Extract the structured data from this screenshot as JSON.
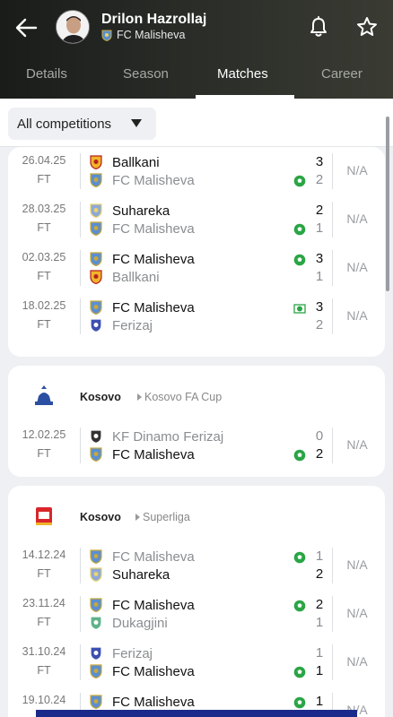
{
  "header": {
    "player_name": "Drilon Hazrollaj",
    "team_name": "FC Malisheva",
    "tabs": [
      {
        "label": "Details"
      },
      {
        "label": "Season"
      },
      {
        "label": "Matches"
      },
      {
        "label": "Career"
      }
    ],
    "active_tab": "Matches",
    "accent_color": "#ffffff"
  },
  "filter": {
    "selected": "All competitions"
  },
  "groups": [
    {
      "matches": [
        {
          "date": "26.04.25",
          "status": "FT",
          "home": "Ballkani",
          "away": "FC Malisheva",
          "home_score": "3",
          "away_score": "2",
          "rating": "N/A"
        },
        {
          "date": "28.03.25",
          "status": "FT",
          "home": "Suhareka",
          "away": "FC Malisheva",
          "home_score": "2",
          "away_score": "1",
          "rating": "N/A"
        },
        {
          "date": "02.03.25",
          "status": "FT",
          "home": "FC Malisheva",
          "away": "Ballkani",
          "home_score": "3",
          "away_score": "1",
          "rating": "N/A"
        },
        {
          "date": "18.02.25",
          "status": "FT",
          "home": "FC Malisheva",
          "away": "Ferizaj",
          "home_score": "3",
          "away_score": "2",
          "rating": "N/A"
        }
      ]
    },
    {
      "country": "Kosovo",
      "competition": "Kosovo FA Cup",
      "matches": [
        {
          "date": "12.02.25",
          "status": "FT",
          "home": "KF Dinamo Ferizaj",
          "away": "FC Malisheva",
          "home_score": "0",
          "away_score": "2",
          "rating": "N/A"
        }
      ]
    },
    {
      "country": "Kosovo",
      "competition": "Superliga",
      "matches": [
        {
          "date": "14.12.24",
          "status": "FT",
          "home": "FC Malisheva",
          "away": "Suhareka",
          "home_score": "1",
          "away_score": "2",
          "rating": "N/A"
        },
        {
          "date": "23.11.24",
          "status": "FT",
          "home": "FC Malisheva",
          "away": "Dukagjini",
          "home_score": "2",
          "away_score": "1",
          "rating": "N/A"
        },
        {
          "date": "31.10.24",
          "status": "FT",
          "home": "Ferizaj",
          "away": "FC Malisheva",
          "home_score": "1",
          "away_score": "1",
          "rating": "N/A"
        },
        {
          "date": "19.10.24",
          "status": "FT",
          "home": "FC Malisheva",
          "away": "",
          "home_score": "1",
          "away_score": "",
          "rating": "N/A"
        }
      ]
    }
  ],
  "icons": [
    "back-arrow-icon",
    "bell-icon",
    "star-icon",
    "dropdown-caret-icon",
    "goal-ball-icon",
    "team-crest-icon",
    "competition-logo-icon"
  ],
  "colors": {
    "goal_icon": "#2aa545",
    "winner_text": "#111111",
    "loser_text": "#8a8d91"
  }
}
